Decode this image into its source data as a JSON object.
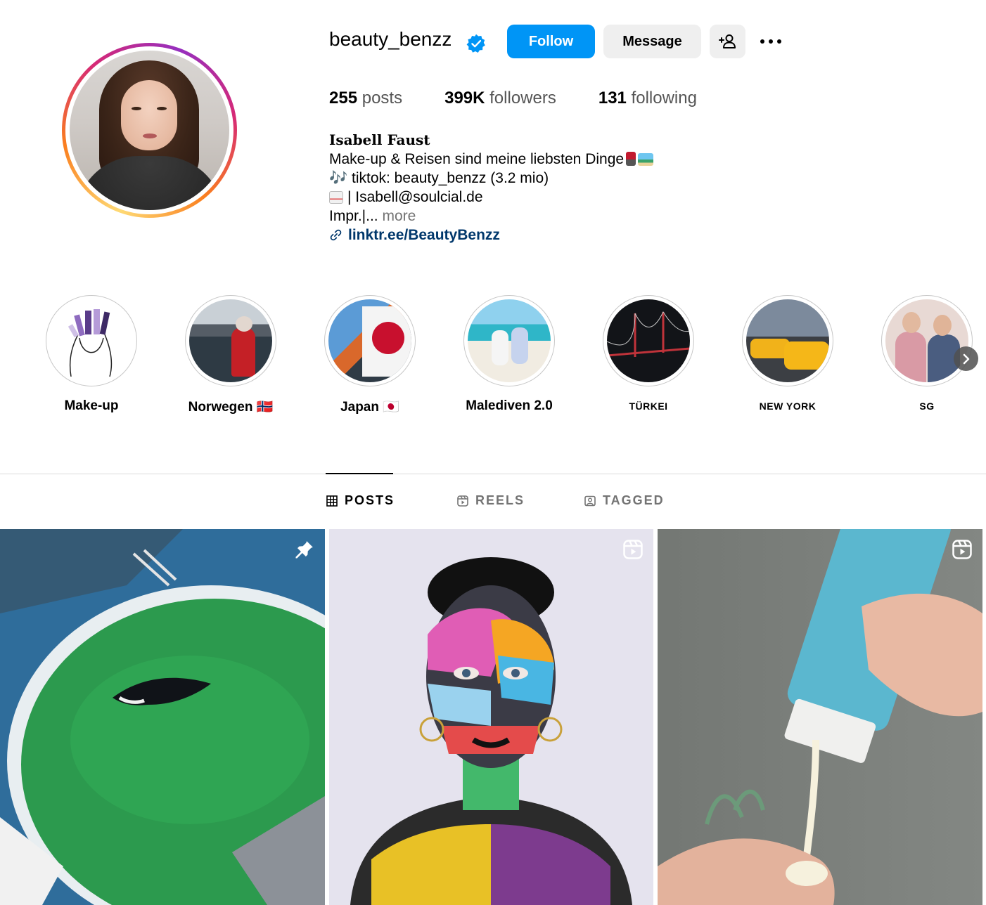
{
  "profile": {
    "username": "beauty_benzz",
    "follow_label": "Follow",
    "message_label": "Message"
  },
  "stats": {
    "posts_count": "255",
    "posts_label": "posts",
    "followers_count": "399K",
    "followers_label": "followers",
    "following_count": "131",
    "following_label": "following"
  },
  "bio": {
    "full_name": "Isabell Faust",
    "line1": "Make-up & Reisen sind meine liebsten Dinge",
    "line2": "🎶 tiktok: beauty_benzz (3.2 mio)",
    "line3": "| Isabell@soulcial.de",
    "line4": "Impr.|...",
    "more_label": "more",
    "link": "linktr.ee/BeautyBenzz"
  },
  "highlights": [
    {
      "label": "Make-up"
    },
    {
      "label": "Norwegen 🇳🇴"
    },
    {
      "label": "Japan 🇯🇵"
    },
    {
      "label": "Malediven 2.0"
    },
    {
      "label": "TÜRKEI"
    },
    {
      "label": "NEW YORK"
    },
    {
      "label": "SG"
    }
  ],
  "tabs": [
    {
      "label": "POSTS",
      "icon": "grid-icon",
      "active": true
    },
    {
      "label": "REELS",
      "icon": "reels-icon",
      "active": false
    },
    {
      "label": "TAGGED",
      "icon": "tagged-icon",
      "active": false
    }
  ],
  "posts": [
    {
      "type": "pinned",
      "icon": "pin-icon"
    },
    {
      "type": "reel",
      "icon": "reel-icon"
    },
    {
      "type": "reel",
      "icon": "reel-icon"
    }
  ],
  "colors": {
    "accent": "#0095f6",
    "link": "#00376b",
    "muted": "#737373"
  }
}
